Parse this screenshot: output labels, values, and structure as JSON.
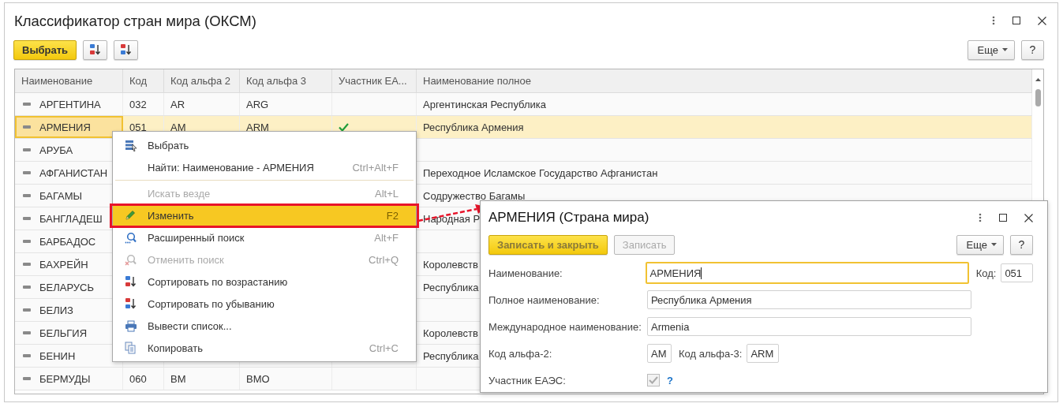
{
  "window": {
    "title": "Классификатор стран мира (ОКСМ)"
  },
  "toolbar": {
    "primary": "Выбрать",
    "more": "Еще",
    "help": "?"
  },
  "table": {
    "columns": [
      "Наименование",
      "Код",
      "Код альфа 2",
      "Код альфа 3",
      "Участник ЕА...",
      "Наименование полное"
    ],
    "rows": [
      {
        "name": "АРГЕНТИНА",
        "code": "032",
        "alpha2": "AR",
        "alpha3": "ARG",
        "eaeu": false,
        "full": "Аргентинская Республика",
        "selected": false
      },
      {
        "name": "АРМЕНИЯ",
        "code": "051",
        "alpha2": "AM",
        "alpha3": "ARM",
        "eaeu": true,
        "full": "Республика Армения",
        "selected": true
      },
      {
        "name": "АРУБА",
        "selected": false
      },
      {
        "name": "АФГАНИСТАН",
        "full": "Переходное Исламское Государство Афганистан",
        "selected": false
      },
      {
        "name": "БАГАМЫ",
        "full": "Содружество Багамы",
        "selected": false
      },
      {
        "name": "БАНГЛАДЕШ",
        "full": "Народная Р",
        "selected": false
      },
      {
        "name": "БАРБАДОС",
        "selected": false
      },
      {
        "name": "БАХРЕЙН",
        "full": "Королевств",
        "selected": false
      },
      {
        "name": "БЕЛАРУСЬ",
        "full": "Республика",
        "selected": false
      },
      {
        "name": "БЕЛИЗ",
        "selected": false
      },
      {
        "name": "БЕЛЬГИЯ",
        "full": "Королевств",
        "selected": false
      },
      {
        "name": "БЕНИН",
        "full": "Республика",
        "selected": false
      },
      {
        "name": "БЕРМУДЫ",
        "code": "060",
        "alpha2": "BM",
        "alpha3": "BMO",
        "selected": false
      }
    ]
  },
  "menu": {
    "items": [
      {
        "kind": "item",
        "label": "Выбрать",
        "disabled": false,
        "selected": false
      },
      {
        "kind": "item",
        "label": "Найти: Наименование - АРМЕНИЯ",
        "shortcut": "Ctrl+Alt+F",
        "disabled": false,
        "selected": false
      },
      {
        "kind": "separator"
      },
      {
        "kind": "item",
        "label": "Искать везде",
        "shortcut": "Alt+L",
        "disabled": true,
        "selected": false
      },
      {
        "kind": "item",
        "label": "Изменить",
        "shortcut": "F2",
        "disabled": false,
        "selected": true
      },
      {
        "kind": "item",
        "label": "Расширенный поиск",
        "shortcut": "Alt+F",
        "disabled": false,
        "selected": false
      },
      {
        "kind": "item",
        "label": "Отменить поиск",
        "shortcut": "Ctrl+Q",
        "disabled": true,
        "selected": false
      },
      {
        "kind": "item",
        "label": "Сортировать по возрастанию",
        "disabled": false,
        "selected": false
      },
      {
        "kind": "item",
        "label": "Сортировать по убыванию",
        "disabled": false,
        "selected": false
      },
      {
        "kind": "item",
        "label": "Вывести список...",
        "disabled": false,
        "selected": false
      },
      {
        "kind": "item",
        "label": "Копировать",
        "shortcut": "Ctrl+C",
        "disabled": false,
        "selected": false
      }
    ]
  },
  "dialog": {
    "title": "АРМЕНИЯ (Страна мира)",
    "buttons": [
      {
        "label": "Записать и закрыть",
        "kind": "primary",
        "disabled": false
      },
      {
        "label": "Записать",
        "kind": "default",
        "disabled": true
      }
    ],
    "more": "Еще",
    "help": "?",
    "name": {
      "label": "Наименование:",
      "value": "АРМЕНИЯ",
      "focused": true
    },
    "code": {
      "label": "Код:",
      "value": "051"
    },
    "full_name": {
      "label": "Полное наименование:",
      "value": "Республика Армения"
    },
    "intl_name": {
      "label": "Международное наименование:",
      "value": "Armenia"
    },
    "alpha2": {
      "label": "Код альфа-2:",
      "value": "AM"
    },
    "alpha3": {
      "label": "Код альфа-3:",
      "value": "ARM"
    },
    "eaeu": {
      "label": "Участник ЕАЭС:",
      "checked": true,
      "disabled": true,
      "hint": "?"
    }
  }
}
